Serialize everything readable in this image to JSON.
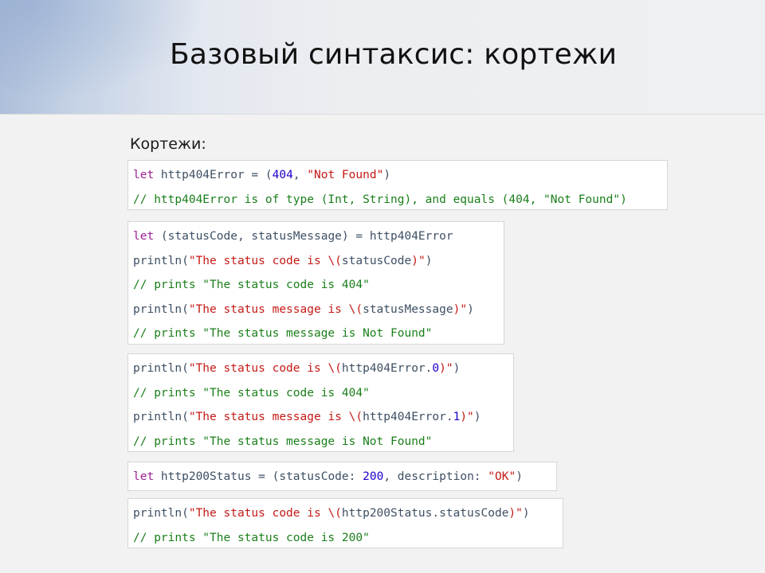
{
  "slide": {
    "title": "Базовый синтаксис: кортежи",
    "section_label": "Кортежи:"
  },
  "colors": {
    "keyword": "#9b2393",
    "string": "#c41a16",
    "comment": "#1a7f1a",
    "number": "#1c00cf",
    "identifier": "#3d4f63"
  },
  "code_blocks": [
    {
      "lines": [
        [
          {
            "t": "let",
            "k": "kw"
          },
          {
            "t": " http404Error = (",
            "k": "plain"
          },
          {
            "t": "404",
            "k": "num"
          },
          {
            "t": ", ",
            "k": "plain"
          },
          {
            "t": "\"Not Found\"",
            "k": "str"
          },
          {
            "t": ")",
            "k": "plain"
          }
        ],
        [
          {
            "t": "// http404Error is of type (Int, String), and equals (404, \"Not Found\")",
            "k": "cmt"
          }
        ]
      ]
    },
    {
      "lines": [
        [
          {
            "t": "let",
            "k": "kw"
          },
          {
            "t": " (statusCode, statusMessage) = http404Error",
            "k": "plain"
          }
        ],
        [
          {
            "t": "println(",
            "k": "plain"
          },
          {
            "t": "\"The status code is \\(",
            "k": "str"
          },
          {
            "t": "statusCode",
            "k": "plain"
          },
          {
            "t": ")\"",
            "k": "str"
          },
          {
            "t": ")",
            "k": "plain"
          }
        ],
        [
          {
            "t": "// prints \"The status code is 404\"",
            "k": "cmt"
          }
        ],
        [
          {
            "t": "println(",
            "k": "plain"
          },
          {
            "t": "\"The status message is \\(",
            "k": "str"
          },
          {
            "t": "statusMessage",
            "k": "plain"
          },
          {
            "t": ")\"",
            "k": "str"
          },
          {
            "t": ")",
            "k": "plain"
          }
        ],
        [
          {
            "t": "// prints \"The status message is Not Found\"",
            "k": "cmt"
          }
        ]
      ]
    },
    {
      "lines": [
        [
          {
            "t": "println(",
            "k": "plain"
          },
          {
            "t": "\"The status code is \\(",
            "k": "str"
          },
          {
            "t": "http404Error.",
            "k": "plain"
          },
          {
            "t": "0",
            "k": "num"
          },
          {
            "t": ")\"",
            "k": "str"
          },
          {
            "t": ")",
            "k": "plain"
          }
        ],
        [
          {
            "t": "// prints \"The status code is 404\"",
            "k": "cmt"
          }
        ],
        [
          {
            "t": "println(",
            "k": "plain"
          },
          {
            "t": "\"The status message is \\(",
            "k": "str"
          },
          {
            "t": "http404Error.",
            "k": "plain"
          },
          {
            "t": "1",
            "k": "num"
          },
          {
            "t": ")\"",
            "k": "str"
          },
          {
            "t": ")",
            "k": "plain"
          }
        ],
        [
          {
            "t": "// prints \"The status message is Not Found\"",
            "k": "cmt"
          }
        ]
      ]
    },
    {
      "lines": [
        [
          {
            "t": "let",
            "k": "kw"
          },
          {
            "t": " http200Status = (statusCode: ",
            "k": "plain"
          },
          {
            "t": "200",
            "k": "num"
          },
          {
            "t": ", description: ",
            "k": "plain"
          },
          {
            "t": "\"OK\"",
            "k": "str"
          },
          {
            "t": ")",
            "k": "plain"
          }
        ]
      ]
    },
    {
      "lines": [
        [
          {
            "t": "println(",
            "k": "plain"
          },
          {
            "t": "\"The status code is \\(",
            "k": "str"
          },
          {
            "t": "http200Status.statusCode",
            "k": "plain"
          },
          {
            "t": ")\"",
            "k": "str"
          },
          {
            "t": ")",
            "k": "plain"
          }
        ],
        [
          {
            "t": "// prints \"The status code is 200\"",
            "k": "cmt"
          }
        ]
      ]
    }
  ]
}
